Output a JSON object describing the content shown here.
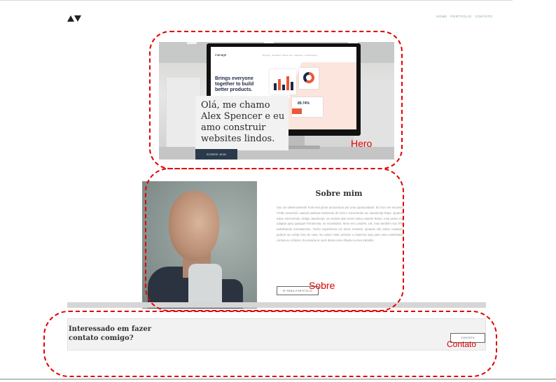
{
  "header": {
    "logo_icon": "triangle-logo-icon",
    "nav": [
      "HOME",
      "PORTFOLIO",
      "CONTATO"
    ]
  },
  "hero": {
    "title": "Olá, me chamo Alex Spencer e eu amo construir websites lindos.",
    "button": "SOBRE MIM",
    "screen": {
      "brand": "manage",
      "nav_items": [
        "Pricing",
        "Product",
        "About Us",
        "Careers",
        "Community"
      ],
      "headline": "Brings everyone together to build better products.",
      "stat": "89.74%"
    }
  },
  "about": {
    "title": "Sobre mim",
    "text": "Sou um desenvolvedor front-end júnior procurando por uma oportunidade. Eu foco em escrever HTML acessível, usando práticas modernas de CSS e escrevendo um JavaScript limpo. Quando estou escrevendo código JavaScript, na maioria das vezes estou usando React, mas posso me adaptar para qualquer ferramenta, se necessário. Moro em Londres, UK, mas também sou feliz trabalhando remotamente. Tenho experiência em times remotos. Quando não estou codando, poderá me achar fora de casa. Eu adoro estar próximo a natureza seja para uma caminhada, corrida ou ciclismo. Eu amaria se você desse uma olhada no meu trabalho.",
    "button": "IR PARA PORTFOLIO"
  },
  "contact": {
    "text": "Interessado em fazer contato comigo?",
    "button": "CONTATO"
  },
  "annotations": {
    "hero": "Hero",
    "about": "Sobre",
    "contact": "Contato",
    "color": "#e00000"
  }
}
